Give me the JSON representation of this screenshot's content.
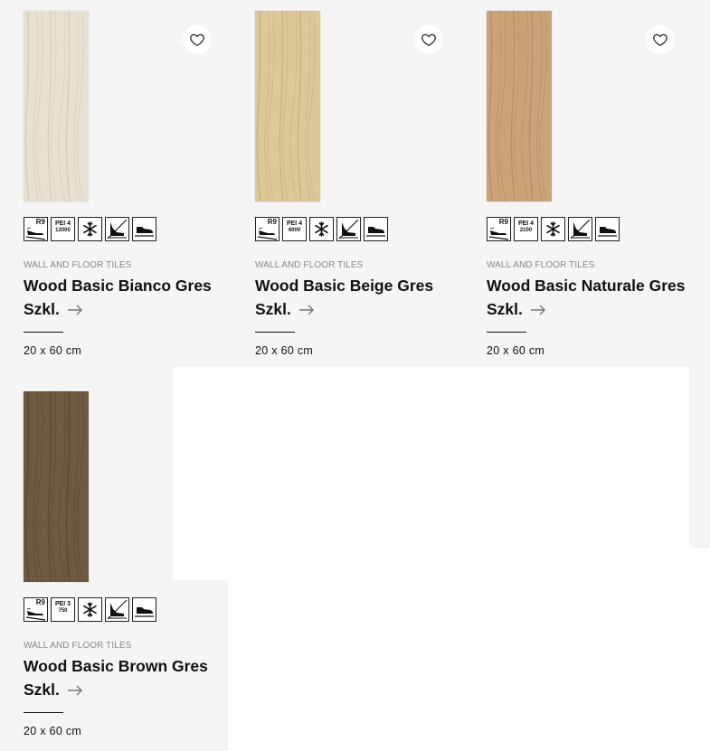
{
  "products": [
    {
      "category": "WALL AND FLOOR TILES",
      "name": "Wood Basic Bianco Gres Szkl.",
      "size": "20 x 60 cm",
      "tile_color": "#e6e1d3",
      "tile_grain": "#cfc8b6",
      "slip_rating": "R9",
      "pei_class": "PEI 4",
      "pei_cycles": "12000",
      "favorite_icon": "heart-icon",
      "has_favorite": true
    },
    {
      "category": "WALL AND FLOOR TILES",
      "name": "Wood Basic Beige Gres Szkl.",
      "size": "20 x 60 cm",
      "tile_color": "#dcc898",
      "tile_grain": "#c4ad78",
      "slip_rating": "R9",
      "pei_class": "PEI 4",
      "pei_cycles": "6000",
      "favorite_icon": "heart-icon",
      "has_favorite": true
    },
    {
      "category": "WALL AND FLOOR TILES",
      "name": "Wood Basic Naturale Gres Szkl.",
      "size": "20 x 60 cm",
      "tile_color": "#c8a478",
      "tile_grain": "#ad8a5e",
      "slip_rating": "R9",
      "pei_class": "PEI 4",
      "pei_cycles": "2100",
      "favorite_icon": "heart-icon",
      "has_favorite": true
    },
    {
      "category": "WALL AND FLOOR TILES",
      "name": "Wood Basic Brown Gres Szkl.",
      "size": "20 x 60 cm",
      "tile_color": "#6e5a40",
      "tile_grain": "#584630",
      "slip_rating": "R9",
      "pei_class": "PEI 3",
      "pei_cycles": "750",
      "favorite_icon": "heart-icon",
      "has_favorite": false
    }
  ],
  "feature_icons": [
    "slip-resistance-icon",
    "pei-abrasion-icon",
    "frost-resistant-icon",
    "chemical-resistance-icon",
    "floor-use-shoe-icon"
  ],
  "arrow_icon": "arrow-right-icon"
}
